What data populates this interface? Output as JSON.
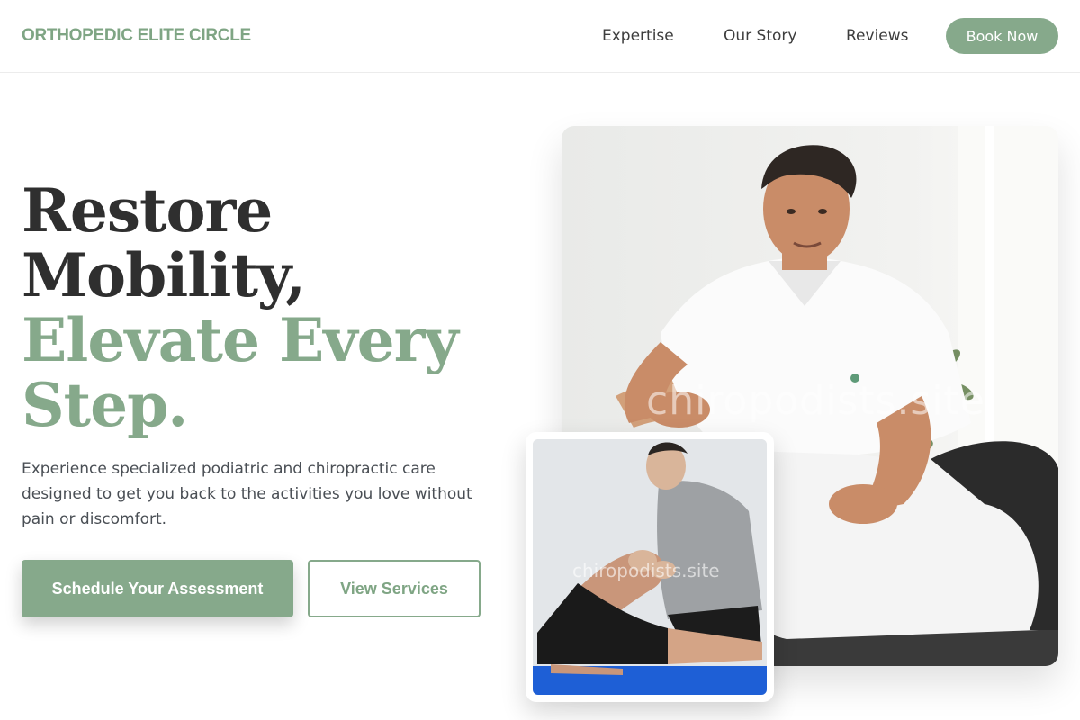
{
  "brand": {
    "name": "ORTHOPEDIC ELITE CIRCLE",
    "accent_color": "#86a98b"
  },
  "nav": {
    "links": [
      {
        "label": "Expertise"
      },
      {
        "label": "Our Story"
      },
      {
        "label": "Reviews"
      }
    ],
    "cta_label": "Book Now"
  },
  "hero": {
    "title_line1": "Restore",
    "title_line2": "Mobility,",
    "title_line3": "Elevate Every",
    "title_line4": "Step.",
    "subtitle": "Experience specialized podiatric and chiropractic care designed to get you back to the activities you love without pain or discomfort.",
    "primary_cta": "Schedule Your Assessment",
    "secondary_cta": "View Services"
  },
  "images": {
    "main_watermark": "chiropodists.site",
    "inset_watermark": "chiropodists.site"
  }
}
